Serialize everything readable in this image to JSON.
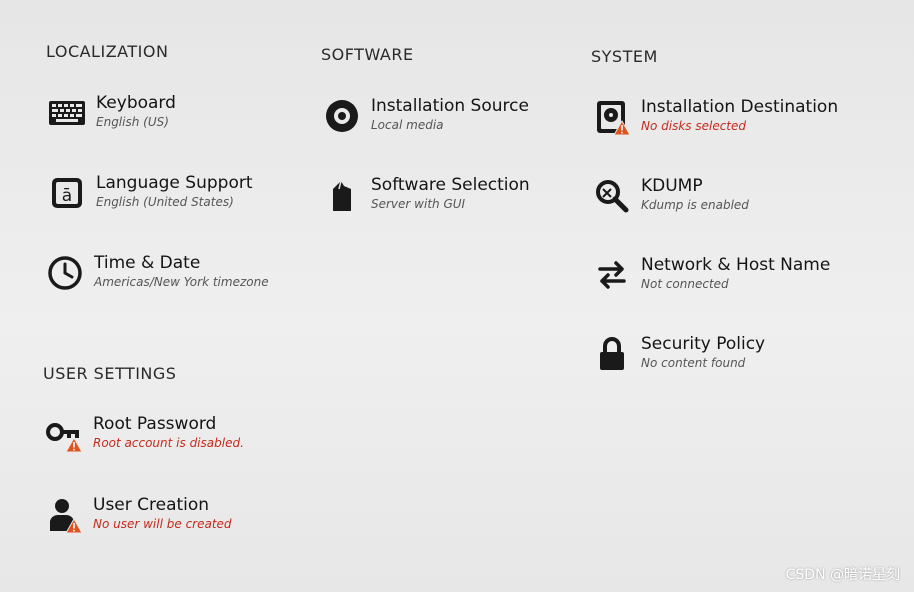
{
  "sections": {
    "localization": "LOCALIZATION",
    "software": "SOFTWARE",
    "system": "SYSTEM",
    "user_settings": "USER SETTINGS"
  },
  "spokes": {
    "keyboard": {
      "title": "Keyboard",
      "status": "English (US)",
      "icon": "keyboard-icon"
    },
    "language": {
      "title": "Language Support",
      "status": "English (United States)",
      "icon": "language-icon"
    },
    "time_date": {
      "title": "Time & Date",
      "status": "Americas/New York timezone",
      "icon": "clock-icon"
    },
    "install_source": {
      "title": "Installation Source",
      "status": "Local media",
      "icon": "disc-icon"
    },
    "software_selection": {
      "title": "Software Selection",
      "status": "Server with GUI",
      "icon": "package-icon"
    },
    "install_dest": {
      "title": "Installation Destination",
      "status": "No disks selected",
      "icon": "hard-disk-icon",
      "warning": true
    },
    "kdump": {
      "title": "KDUMP",
      "status": "Kdump is enabled",
      "icon": "search-icon"
    },
    "network": {
      "title": "Network & Host Name",
      "status": "Not connected",
      "icon": "network-arrows-icon"
    },
    "security": {
      "title": "Security Policy",
      "status": "No content found",
      "icon": "lock-icon"
    },
    "root_password": {
      "title": "Root Password",
      "status": "Root account is disabled.",
      "icon": "key-icon",
      "warning": true
    },
    "user_creation": {
      "title": "User Creation",
      "status": "No user will be created",
      "icon": "user-icon",
      "warning": true
    }
  },
  "colors": {
    "warning": "#c62a1d",
    "badge": "#e0531e",
    "text": "#141414",
    "status": "#555555"
  },
  "watermark": "CSDN @暗诺星刻"
}
